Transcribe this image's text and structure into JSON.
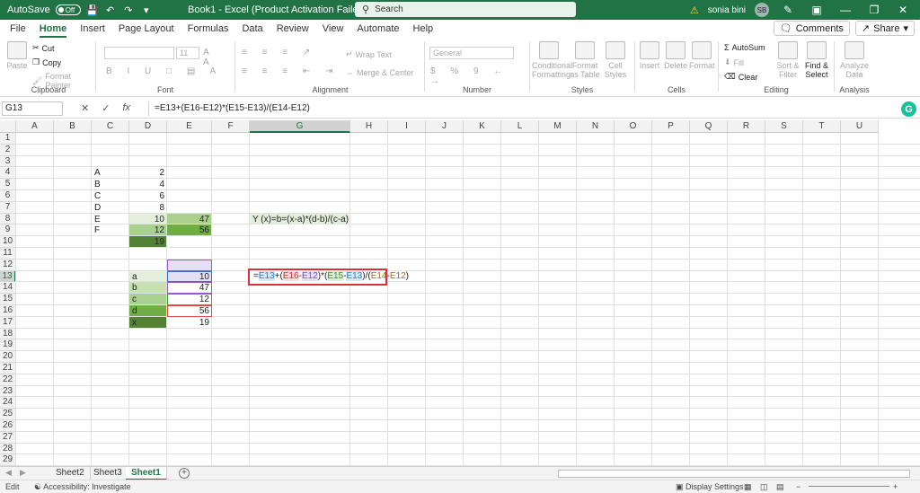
{
  "titlebar": {
    "autosave_label": "AutoSave",
    "autosave_state": "Off",
    "doc_title": "Book1  -  Excel (Product Activation Failed)",
    "search_placeholder": "Search",
    "user_name": "sonia bini",
    "user_initials": "SB",
    "accent_color": "#217346"
  },
  "tabs": [
    "File",
    "Home",
    "Insert",
    "Page Layout",
    "Formulas",
    "Data",
    "Review",
    "View",
    "Automate",
    "Help"
  ],
  "active_tab": "Home",
  "tab_actions": {
    "comments": "Comments",
    "share": "Share"
  },
  "ribbon": {
    "clipboard": {
      "paste": "Paste",
      "cut": "Cut",
      "copy": "Copy",
      "format_painter": "Format Painter",
      "label": "Clipboard"
    },
    "font": {
      "font_name": "",
      "font_size": "11",
      "label": "Font"
    },
    "alignment": {
      "wrap_text": "Wrap Text",
      "merge_center": "Merge & Center",
      "label": "Alignment"
    },
    "number": {
      "format": "General",
      "label": "Number"
    },
    "styles": {
      "conditional_formatting": "Conditional Formatting",
      "format_as_table": "Format as Table",
      "cell_styles": "Cell Styles",
      "label": "Styles"
    },
    "cells": {
      "insert": "Insert",
      "delete": "Delete",
      "format": "Format",
      "label": "Cells"
    },
    "editing": {
      "autosum": "AutoSum",
      "fill": "Fill",
      "clear": "Clear",
      "sort_filter": "Sort & Filter",
      "find_select": "Find & Select",
      "label": "Editing"
    },
    "analysis": {
      "analyze_data": "Analyze Data",
      "label": "Analysis"
    }
  },
  "formula_bar": {
    "name_box": "G13",
    "formula": "=E13+(E16-E12)*(E15-E13)/(E14-E12)"
  },
  "columns": [
    "A",
    "B",
    "C",
    "D",
    "E",
    "F",
    "G",
    "H",
    "I",
    "J",
    "K",
    "L",
    "M",
    "N",
    "O",
    "P",
    "Q",
    "R",
    "S",
    "T",
    "U"
  ],
  "rows": [
    "1",
    "2",
    "3",
    "4",
    "5",
    "6",
    "7",
    "8",
    "9",
    "10",
    "11",
    "12",
    "13",
    "14",
    "15",
    "16",
    "17",
    "18",
    "19",
    "20",
    "21",
    "22",
    "23",
    "24",
    "25",
    "26",
    "27",
    "28",
    "29"
  ],
  "cells": {
    "C4": "A",
    "D4": "2",
    "C5": "B",
    "D5": "4",
    "C6": "C",
    "D6": "6",
    "C7": "D",
    "D7": "8",
    "C8": "E",
    "D8": "10",
    "E8": "47",
    "C9": "F",
    "D9": "12",
    "E9": "56",
    "D10": "19",
    "G8": "Y (x)=b=(x-a)*(d-b)/(c-a)",
    "D13": "a",
    "E13": "10",
    "D14": "b",
    "E14": "47",
    "D15": "c",
    "E15": "12",
    "D16": "d",
    "E16": "56",
    "D17": "x",
    "E17": "19"
  },
  "editing_cell": {
    "p1": "=",
    "r1": "E13",
    "p2": "+(",
    "r2": "E16",
    "p3": "-",
    "r3": "E12",
    "p4": ")*(",
    "r4": "E15",
    "p5": "-",
    "r5": "E13",
    "p6": ")/(",
    "r6": "E14",
    "p7": "-",
    "r7": "E12",
    "p8": ")"
  },
  "sheets": [
    "Sheet2",
    "Sheet3",
    "Sheet1"
  ],
  "active_sheet": "Sheet1",
  "status": {
    "mode": "Edit",
    "accessibility": "Accessibility: Investigate",
    "display_settings": "Display Settings"
  }
}
